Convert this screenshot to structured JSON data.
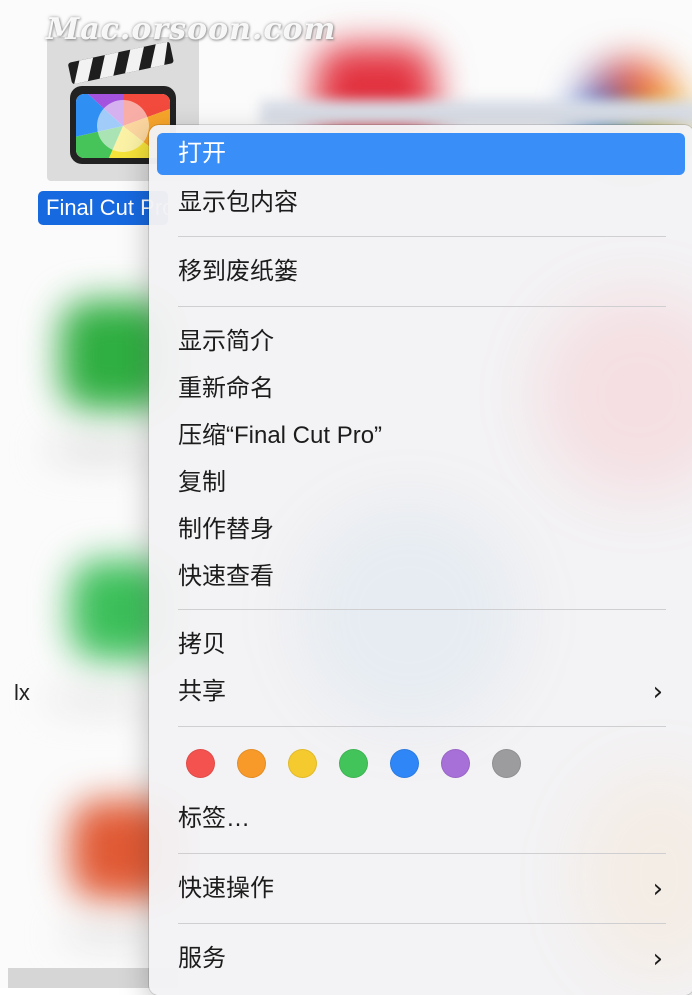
{
  "watermark": "Mac.orsoon.com",
  "desktop": {
    "selected_app_label": "Final Cut Pro",
    "side_label": "lx"
  },
  "context_menu": {
    "items": {
      "open": "打开",
      "show_package_contents": "显示包内容",
      "move_to_trash": "移到废纸篓",
      "get_info": "显示简介",
      "rename": "重新命名",
      "compress": "压缩“Final Cut Pro”",
      "duplicate": "复制",
      "make_alias": "制作替身",
      "quick_look": "快速查看",
      "copy": "拷贝",
      "share": "共享",
      "tags": "标签…",
      "quick_actions": "快速操作",
      "services": "服务"
    },
    "submenu_chevron": "›",
    "tag_colors": {
      "red": "#f4524f",
      "orange": "#f79a2a",
      "yellow": "#f5ca2e",
      "green": "#43c45a",
      "blue": "#2f86f6",
      "purple": "#a76fd8",
      "gray": "#9c9c9e"
    },
    "highlight_color": "#3a8ef8"
  }
}
